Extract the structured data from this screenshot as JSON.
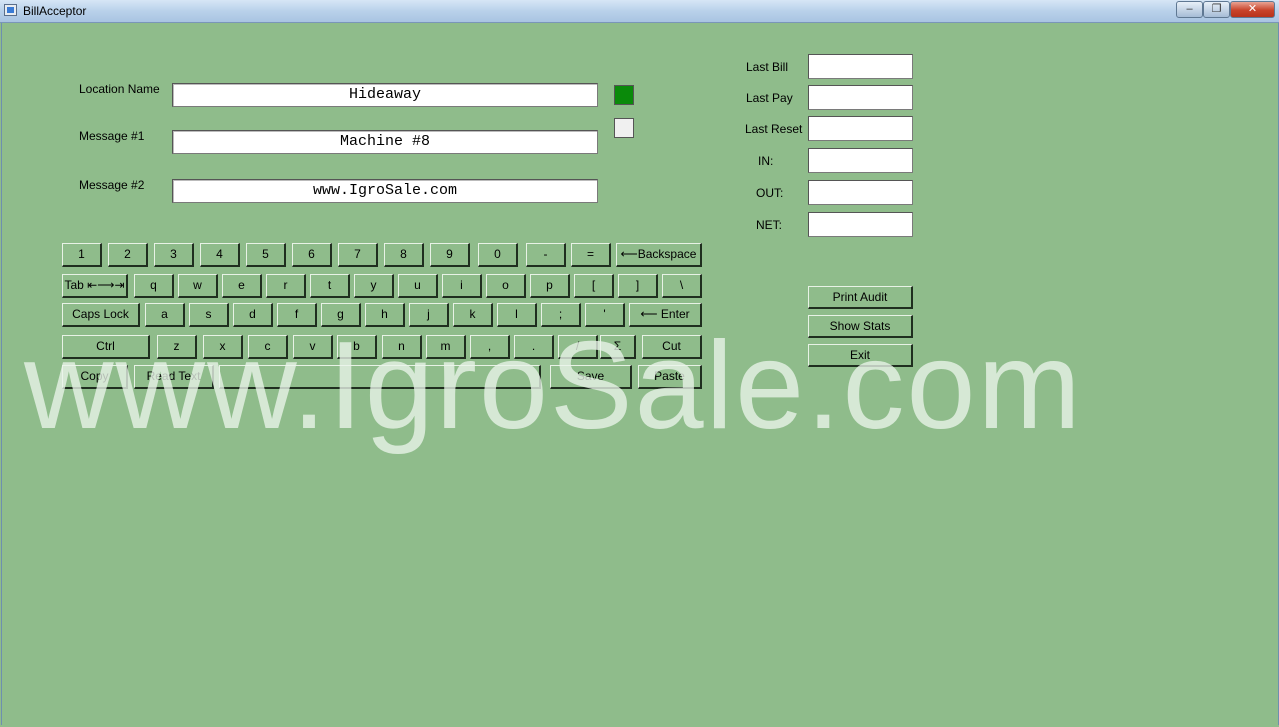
{
  "window": {
    "title": "BillAcceptor",
    "controls": {
      "minimize": "‒",
      "maximize": "❐",
      "close": "✕"
    }
  },
  "form": {
    "location_name_label": "Location Name",
    "location_name_value": "Hideaway",
    "message1_label": "Message #1",
    "message1_value": "Machine #8",
    "message2_label": "Message #2",
    "message2_value": "www.IgroSale.com",
    "status_indicators": [
      {
        "name": "active",
        "color": "#0a8a0a"
      },
      {
        "name": "inactive",
        "color": "#f0f0f0"
      }
    ]
  },
  "stats": {
    "last_bill_label": "Last Bill",
    "last_pay_label": "Last Pay",
    "last_reset_label": "Last Reset",
    "in_label": "IN:",
    "out_label": "OUT:",
    "net_label": "NET:",
    "last_bill_value": "",
    "last_pay_value": "",
    "last_reset_value": "",
    "in_value": "",
    "out_value": "",
    "net_value": ""
  },
  "actions": {
    "print_audit": "Print Audit",
    "show_stats": "Show Stats",
    "exit": "Exit"
  },
  "keyboard": {
    "row1": [
      "1",
      "2",
      "3",
      "4",
      "5",
      "6",
      "7",
      "8",
      "9",
      "0",
      "-",
      "=",
      "⟵Backspace"
    ],
    "row2": [
      "Tab ⇤⟶⇥",
      "q",
      "w",
      "e",
      "r",
      "t",
      "y",
      "u",
      "i",
      "o",
      "p",
      "[",
      "]",
      "\\"
    ],
    "row3": [
      "Caps Lock",
      "a",
      "s",
      "d",
      "f",
      "g",
      "h",
      "j",
      "k",
      "l",
      ";",
      "'",
      "⟵ Enter"
    ],
    "row4": [
      "Ctrl",
      "z",
      "x",
      "c",
      "v",
      "b",
      "n",
      "m",
      ",",
      ".",
      "/",
      "Σ",
      "Cut"
    ],
    "row5": [
      "Copy",
      "Read Text",
      "",
      "Save",
      "Paste"
    ]
  },
  "watermark": "www.IgroSale.com",
  "colors": {
    "background": "#8fbc8b"
  }
}
